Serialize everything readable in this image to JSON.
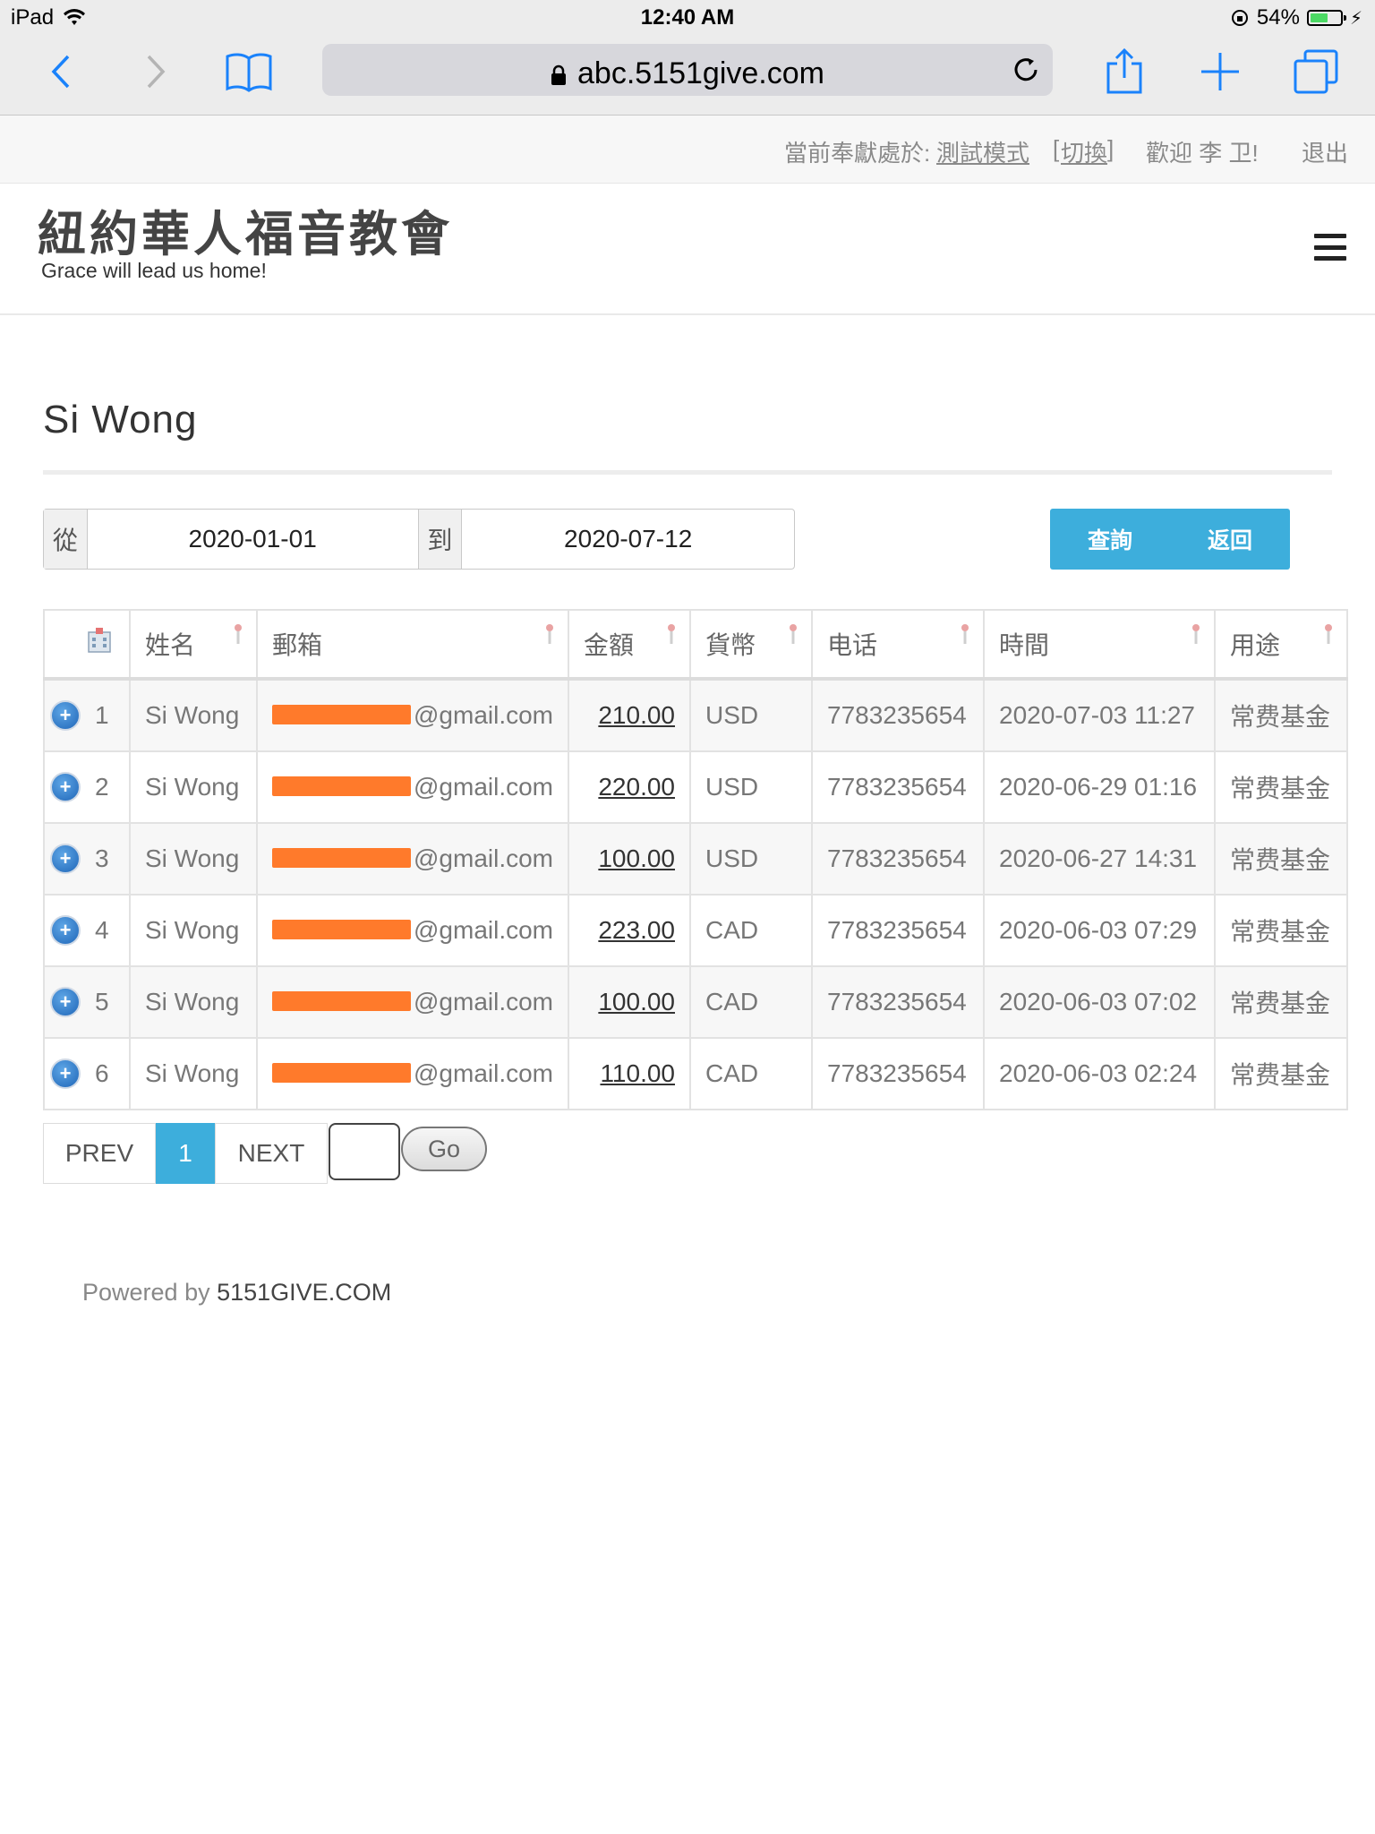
{
  "status_bar": {
    "device": "iPad",
    "time": "12:40 AM",
    "battery": "54%"
  },
  "browser": {
    "url": "abc.5151give.com"
  },
  "top_strip": {
    "mode_prefix": "當前奉獻處於:",
    "mode_value": "測試模式",
    "switch_open": "[",
    "switch_label": "切換",
    "switch_close": "]",
    "welcome": "歡迎 李 卫!",
    "logout": "退出"
  },
  "header": {
    "title": "紐約華人福音教會",
    "tagline": "Grace will lead us home!"
  },
  "page": {
    "title": "Si Wong"
  },
  "filter": {
    "from_label": "從",
    "from_value": "2020-01-01",
    "to_label": "到",
    "to_value": "2020-07-12",
    "query_button": "查詢",
    "back_button": "返回"
  },
  "table": {
    "columns": [
      "",
      "姓名",
      "郵箱",
      "金額",
      "貨幣",
      "电话",
      "時間",
      "用途"
    ],
    "rows": [
      {
        "index": "1",
        "name": "Si Wong",
        "email_visible": "@gmail.com",
        "amount": "210.00",
        "currency": "USD",
        "phone": "7783235654",
        "time": "2020-07-03 11:27",
        "purpose": "常费基金"
      },
      {
        "index": "2",
        "name": "Si Wong",
        "email_visible": "@gmail.com",
        "amount": "220.00",
        "currency": "USD",
        "phone": "7783235654",
        "time": "2020-06-29 01:16",
        "purpose": "常费基金"
      },
      {
        "index": "3",
        "name": "Si Wong",
        "email_visible": "@gmail.com",
        "amount": "100.00",
        "currency": "USD",
        "phone": "7783235654",
        "time": "2020-06-27 14:31",
        "purpose": "常费基金"
      },
      {
        "index": "4",
        "name": "Si Wong",
        "email_visible": "@gmail.com",
        "amount": "223.00",
        "currency": "CAD",
        "phone": "7783235654",
        "time": "2020-06-03 07:29",
        "purpose": "常费基金"
      },
      {
        "index": "5",
        "name": "Si Wong",
        "email_visible": "@gmail.com",
        "amount": "100.00",
        "currency": "CAD",
        "phone": "7783235654",
        "time": "2020-06-03 07:02",
        "purpose": "常费基金"
      },
      {
        "index": "6",
        "name": "Si Wong",
        "email_visible": "@gmail.com",
        "amount": "110.00",
        "currency": "CAD",
        "phone": "7783235654",
        "time": "2020-06-03 02:24",
        "purpose": "常费基金"
      }
    ]
  },
  "pagination": {
    "prev": "PREV",
    "current": "1",
    "next": "NEXT",
    "go": "Go"
  },
  "footer": {
    "prefix": "Powered by",
    "brand": "5151GIVE.COM"
  },
  "colors": {
    "accent": "#3daedc",
    "link_red": "#c9151e",
    "redaction": "#ff7a2b",
    "ios_blue": "#1a82fb"
  }
}
